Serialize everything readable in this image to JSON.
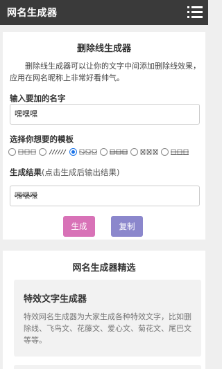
{
  "header": {
    "title": "网名生成器",
    "menu_icon": "hamburger-menu-icon"
  },
  "generator": {
    "heading": "删除线生成器",
    "description": "删除线生成器可以让你的文字中间添加删除线效果，应用在网名昵称上非常好看帅气。",
    "name_label": "输入要加的名字",
    "name_value": "嘿嘿嘿",
    "template_label": "选择你想要的模板",
    "templates": [
      {
        "id": "strike",
        "checked": false
      },
      {
        "id": "slash",
        "checked": false
      },
      {
        "id": "tilde",
        "checked": true
      },
      {
        "id": "double-strike",
        "checked": false
      },
      {
        "id": "cross",
        "checked": false
      },
      {
        "id": "underline-strike",
        "checked": false
      }
    ],
    "result_label": "生成结果",
    "result_hint": "(点击生成后输出结果)",
    "result_value": "嘿嘿嘿",
    "generate_label": "生成",
    "copy_label": "复制"
  },
  "featured": {
    "heading": "网名生成器精选",
    "items": [
      {
        "title": "特效文字生成器",
        "desc": "特效网名生成器为大家生成各种特效文字，比如删除线、飞鸟文、花藤文、爱心文、菊花文、尾巴文等等。"
      }
    ]
  },
  "colors": {
    "topbar": "#3a3a3a",
    "generate_button": "#d872b7",
    "copy_button": "#8b87cc",
    "radio_checked": "#1a73e8"
  }
}
